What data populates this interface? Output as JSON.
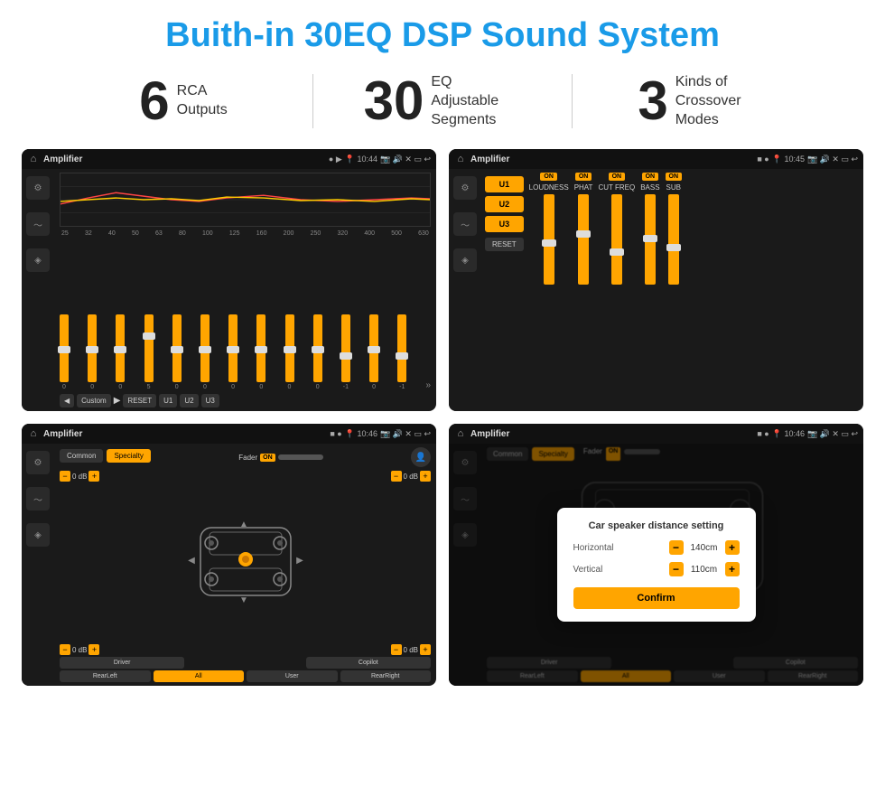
{
  "page": {
    "title": "Buith-in 30EQ DSP Sound System",
    "stats": [
      {
        "number": "6",
        "label": "RCA\nOutputs"
      },
      {
        "number": "30",
        "label": "EQ Adjustable\nSegments"
      },
      {
        "number": "3",
        "label": "Kinds of\nCrossover Modes"
      }
    ],
    "screens": [
      {
        "id": "eq-screen",
        "statusBar": {
          "title": "Amplifier",
          "time": "10:44",
          "dots": "● ▶"
        },
        "freqLabels": [
          "25",
          "32",
          "40",
          "50",
          "63",
          "80",
          "100",
          "125",
          "160",
          "200",
          "250",
          "320",
          "400",
          "500",
          "630"
        ],
        "sliderValues": [
          "0",
          "0",
          "0",
          "5",
          "0",
          "0",
          "0",
          "0",
          "0",
          "0",
          "-1",
          "0",
          "-1"
        ],
        "bottomButtons": [
          "◀",
          "Custom",
          "▶",
          "RESET",
          "U1",
          "U2",
          "U3"
        ]
      },
      {
        "id": "amp-screen",
        "statusBar": {
          "title": "Amplifier",
          "time": "10:45",
          "dots": "■ ●"
        },
        "presets": [
          "U1",
          "U2",
          "U3"
        ],
        "controls": [
          "LOUDNESS",
          "PHAT",
          "CUT FREQ",
          "BASS",
          "SUB"
        ],
        "resetBtn": "RESET"
      },
      {
        "id": "speaker-screen",
        "statusBar": {
          "title": "Amplifier",
          "time": "10:46",
          "dots": "■ ●"
        },
        "tabs": [
          "Common",
          "Specialty"
        ],
        "fader": {
          "label": "Fader",
          "onLabel": "ON"
        },
        "dBValues": [
          "0 dB",
          "0 dB",
          "0 dB",
          "0 dB"
        ],
        "bottomBtns": [
          "Driver",
          "",
          "Copilot",
          "RearLeft",
          "All",
          "User",
          "RearRight"
        ]
      },
      {
        "id": "dialog-screen",
        "statusBar": {
          "title": "Amplifier",
          "time": "10:46",
          "dots": "■ ●"
        },
        "dialog": {
          "title": "Car speaker distance setting",
          "horizontal": {
            "label": "Horizontal",
            "value": "140cm"
          },
          "vertical": {
            "label": "Vertical",
            "value": "110cm"
          },
          "confirmBtn": "Confirm"
        }
      }
    ]
  }
}
